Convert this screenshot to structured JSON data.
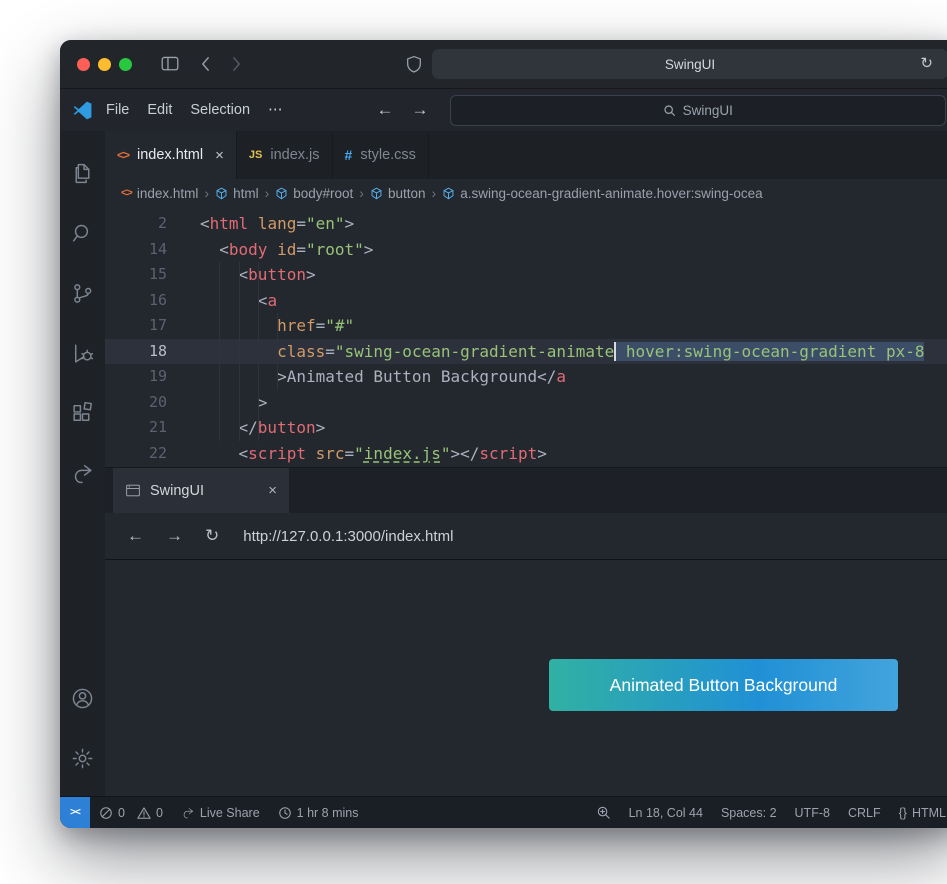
{
  "safari": {
    "title": "SwingUI",
    "reload_glyph": "↻"
  },
  "menubar": {
    "items": [
      "File",
      "Edit",
      "Selection",
      "⋯"
    ],
    "back_glyph": "←",
    "forward_glyph": "→",
    "search_value": "SwingUI"
  },
  "tabs": [
    {
      "icon": "<>",
      "label": "index.html",
      "close": "×",
      "active": true
    },
    {
      "icon": "JS",
      "label": "index.js",
      "active": false
    },
    {
      "icon": "#",
      "label": "style.css",
      "active": false
    }
  ],
  "breadcrumb": {
    "items": [
      "index.html",
      "html",
      "body#root",
      "button",
      "a.swing-ocean-gradient-animate.hover:swing-ocea"
    ]
  },
  "editor": {
    "lines": [
      {
        "num": "2",
        "tokens": [
          {
            "c": "p",
            "t": "<"
          },
          {
            "c": "tag",
            "t": "html"
          },
          {
            "c": "p",
            "t": " "
          },
          {
            "c": "attr",
            "t": "lang"
          },
          {
            "c": "p",
            "t": "="
          },
          {
            "c": "str",
            "t": "\"en\""
          },
          {
            "c": "p",
            "t": ">"
          }
        ]
      },
      {
        "num": "14",
        "tokens": [
          {
            "c": "p",
            "t": "  <"
          },
          {
            "c": "tag",
            "t": "body"
          },
          {
            "c": "p",
            "t": " "
          },
          {
            "c": "attr",
            "t": "id"
          },
          {
            "c": "p",
            "t": "="
          },
          {
            "c": "str",
            "t": "\"root\""
          },
          {
            "c": "p",
            "t": ">"
          }
        ]
      },
      {
        "num": "15",
        "tokens": [
          {
            "c": "p",
            "t": "    <"
          },
          {
            "c": "tag",
            "t": "button"
          },
          {
            "c": "p",
            "t": ">"
          }
        ]
      },
      {
        "num": "16",
        "tokens": [
          {
            "c": "p",
            "t": "      <"
          },
          {
            "c": "tag",
            "t": "a"
          }
        ]
      },
      {
        "num": "17",
        "tokens": [
          {
            "c": "p",
            "t": "        "
          },
          {
            "c": "attr",
            "t": "href"
          },
          {
            "c": "p",
            "t": "="
          },
          {
            "c": "str",
            "t": "\"#\""
          }
        ]
      },
      {
        "num": "18",
        "current": true,
        "tokens": [
          {
            "c": "p",
            "t": "        "
          },
          {
            "c": "attr",
            "t": "class"
          },
          {
            "c": "p",
            "t": "="
          },
          {
            "c": "str",
            "t": "\"swing-ocean-gradient-animate"
          },
          {
            "c": "cursor",
            "t": ""
          },
          {
            "c": "str sel",
            "t": " hover:swing-ocean-gradient px-8"
          }
        ]
      },
      {
        "num": "19",
        "tokens": [
          {
            "c": "p",
            "t": "        >"
          },
          {
            "c": "txt",
            "t": "Animated Button Background"
          },
          {
            "c": "p",
            "t": "</"
          },
          {
            "c": "tag",
            "t": "a"
          }
        ]
      },
      {
        "num": "20",
        "tokens": [
          {
            "c": "p",
            "t": "      >"
          }
        ]
      },
      {
        "num": "21",
        "tokens": [
          {
            "c": "p",
            "t": "    </"
          },
          {
            "c": "tag",
            "t": "button"
          },
          {
            "c": "p",
            "t": ">"
          }
        ]
      },
      {
        "num": "22",
        "tokens": [
          {
            "c": "p",
            "t": "    <"
          },
          {
            "c": "tag",
            "t": "script"
          },
          {
            "c": "p",
            "t": " "
          },
          {
            "c": "attr",
            "t": "src"
          },
          {
            "c": "p",
            "t": "="
          },
          {
            "c": "str",
            "t": "\""
          },
          {
            "c": "link",
            "t": "index.js"
          },
          {
            "c": "str",
            "t": "\""
          },
          {
            "c": "p",
            "t": ">"
          },
          {
            "c": "p",
            "t": "</"
          },
          {
            "c": "tag",
            "t": "script"
          },
          {
            "c": "p",
            "t": ">"
          }
        ]
      }
    ]
  },
  "panel": {
    "tab_label": "SwingUI",
    "close_glyph": "×"
  },
  "browser": {
    "back_glyph": "←",
    "forward_glyph": "→",
    "reload_glyph": "↻",
    "url": "http://127.0.0.1:3000/index.html"
  },
  "preview": {
    "button_label": "Animated Button Background",
    "gradient_left": "#31b1a3",
    "gradient_mid": "#2090d5",
    "gradient_right": "#43a4dc"
  },
  "statusbar": {
    "remote_glyph": "><",
    "errors": "0",
    "warnings": "0",
    "live_share": "Live Share",
    "timer": "1 hr 8 mins",
    "line_col": "Ln 18, Col 44",
    "spaces": "Spaces: 2",
    "encoding": "UTF-8",
    "eol": "CRLF",
    "braces": "{}",
    "language": "HTML"
  },
  "activity_bar": {
    "items": [
      "explorer",
      "search",
      "source-control",
      "run-debug",
      "extensions",
      "live-share"
    ],
    "bottom": [
      "account",
      "settings"
    ]
  }
}
